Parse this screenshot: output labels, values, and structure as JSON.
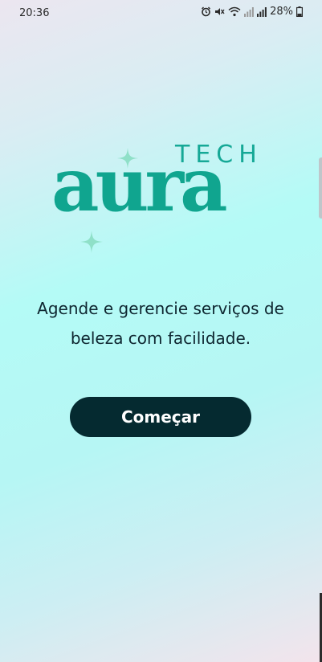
{
  "status_bar": {
    "time": "20:36",
    "battery": "28%",
    "icons": [
      "alarm-icon",
      "mute-icon",
      "wifi-icon",
      "signal-icon",
      "signal-icon",
      "battery-icon"
    ]
  },
  "logo": {
    "tech": "TECH",
    "aura": "aura",
    "color": "#10a58f",
    "sparkle_color": "#8fe0c8"
  },
  "tagline": {
    "line1": "Agende e gerencie serviços de",
    "line2": "beleza com facilidade."
  },
  "start_button": {
    "label": "Começar",
    "background": "#052a30"
  }
}
